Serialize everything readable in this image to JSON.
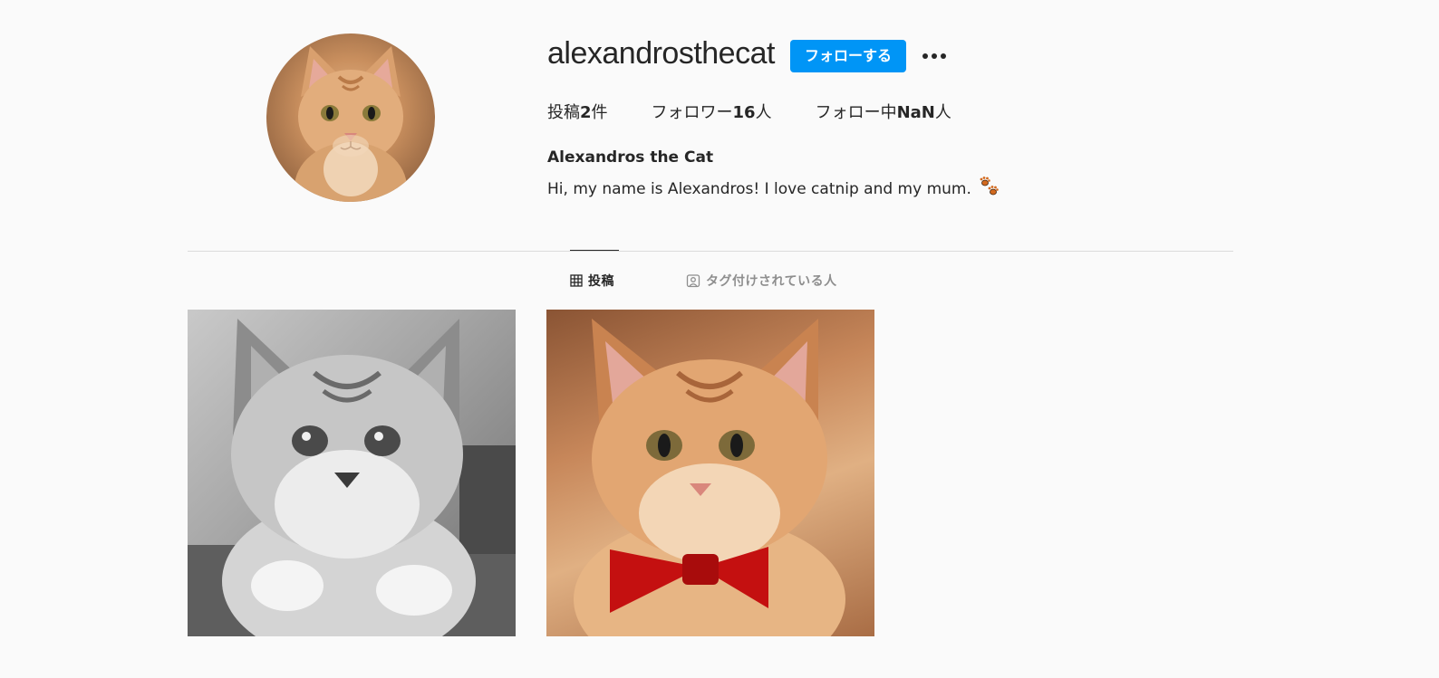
{
  "profile": {
    "username": "alexandrosthecat",
    "follow_label": "フォローする",
    "stats": {
      "posts_prefix": "投稿",
      "posts_count": "2",
      "posts_suffix": "件",
      "followers_prefix": "フォロワー",
      "followers_count": "16",
      "followers_suffix": "人",
      "following_prefix": "フォロー中",
      "following_count": "NaN",
      "following_suffix": "人"
    },
    "full_name": "Alexandros the Cat",
    "bio": "Hi, my name is Alexandros! I love catnip and my mum."
  },
  "tabs": {
    "posts_label": "投稿",
    "tagged_label": "タグ付けされている人"
  },
  "colors": {
    "accent": "#0095f6",
    "text": "#262626",
    "muted": "#8e8e8e",
    "background": "#fafafa"
  },
  "icons": {
    "more": "more-horizontal-icon",
    "grid": "grid-icon",
    "tag": "tagged-person-icon",
    "paw": "paw-prints-icon"
  }
}
